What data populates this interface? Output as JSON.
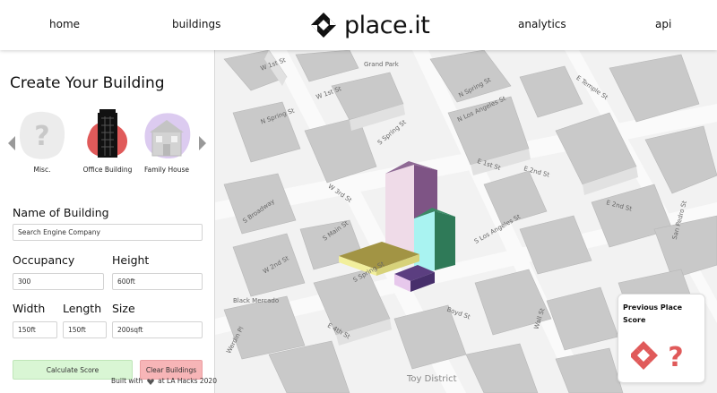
{
  "nav": {
    "home": "home",
    "buildings": "buildings",
    "brand": "place.it",
    "analytics": "analytics",
    "api": "api"
  },
  "panel": {
    "title": "Create Your Building",
    "options": [
      {
        "label": "Misc.",
        "icon": "question-mark-icon"
      },
      {
        "label": "Office Building",
        "icon": "office-building-icon"
      },
      {
        "label": "Family House",
        "icon": "family-house-icon"
      }
    ],
    "name_label": "Name of Building",
    "name_placeholder": "Search Engine Company",
    "occupancy_label": "Occupancy",
    "occupancy_value": "300",
    "height_label": "Height",
    "height_value": "600ft",
    "width_label": "Width",
    "width_value": "150ft",
    "length_label": "Length",
    "length_value": "150ft",
    "size_label": "Size",
    "size_value": "200sqft",
    "calc_button": "Calculate Score",
    "clear_button": "Clear Buildings",
    "footer_prefix": "Built with",
    "footer_suffix": "at LA Hacks 2020"
  },
  "map": {
    "streets": [
      "W 1st St",
      "Grand Park",
      "W 1st St",
      "N Spring St",
      "E Temple St",
      "N Los Angeles St",
      "N Spring St",
      "S Spring St",
      "E 1st St",
      "W 3rd St",
      "S Main St",
      "S Los Angeles St",
      "E 2nd St",
      "E 2nd St",
      "San Pedro St",
      "S Broadway",
      "E 4th St",
      "Boyd St",
      "Wall St",
      "Werdin Pl",
      "Black Mercado",
      "Toy District",
      "S Spring St",
      "W 2nd St"
    ]
  },
  "score_card": {
    "title": "Previous Place Score"
  },
  "colors": {
    "accent_green": "#d9f6d4",
    "accent_red": "#f7b5b7",
    "office_red": "#e05a5a",
    "house_purple": "#d9c8ef"
  }
}
